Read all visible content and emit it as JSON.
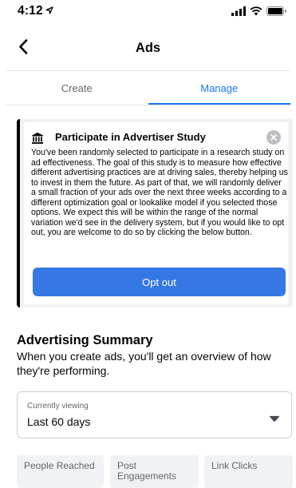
{
  "status_bar": {
    "time": "4:12",
    "icons": [
      "location-arrow-icon",
      "signal-icon",
      "wifi-icon",
      "battery-icon"
    ]
  },
  "nav": {
    "title": "Ads",
    "back_icon": "chevron-left-icon"
  },
  "tabs": [
    {
      "label": "Create",
      "active": false
    },
    {
      "label": "Manage",
      "active": true
    }
  ],
  "study": {
    "icon": "bank-building-icon",
    "title": "Participate in Advertiser Study",
    "close_icon": "close-icon",
    "body": "You've been randomly selected to participate in a research study on ad effectiveness. The goal of this study is to measure how effective different advertising practices are at driving sales, thereby helping us to invest in them the future. As part of that, we will randomly deliver a small fraction of your ads over the next three weeks according to a different optimization goal or lookalike model if you selected those options. We expect this will be within the range of the normal variation we'd see in the delivery system, but if you would like to opt out, you are welcome to do so by clicking the below button.",
    "button_label": "Opt out"
  },
  "summary": {
    "title": "Advertising Summary",
    "description": "When you create ads, you'll get an overview of how they're performing."
  },
  "viewing": {
    "label": "Currently viewing",
    "value": "Last 60 days",
    "caret_icon": "caret-down-icon"
  },
  "metrics": [
    {
      "label": "People Reached"
    },
    {
      "label": "Post Engagements"
    },
    {
      "label": "Link Clicks"
    }
  ],
  "colors": {
    "accent": "#1877f2",
    "button": "#3578e5",
    "card_bg": "#f0f2f5",
    "secondary_text": "#65676b"
  }
}
